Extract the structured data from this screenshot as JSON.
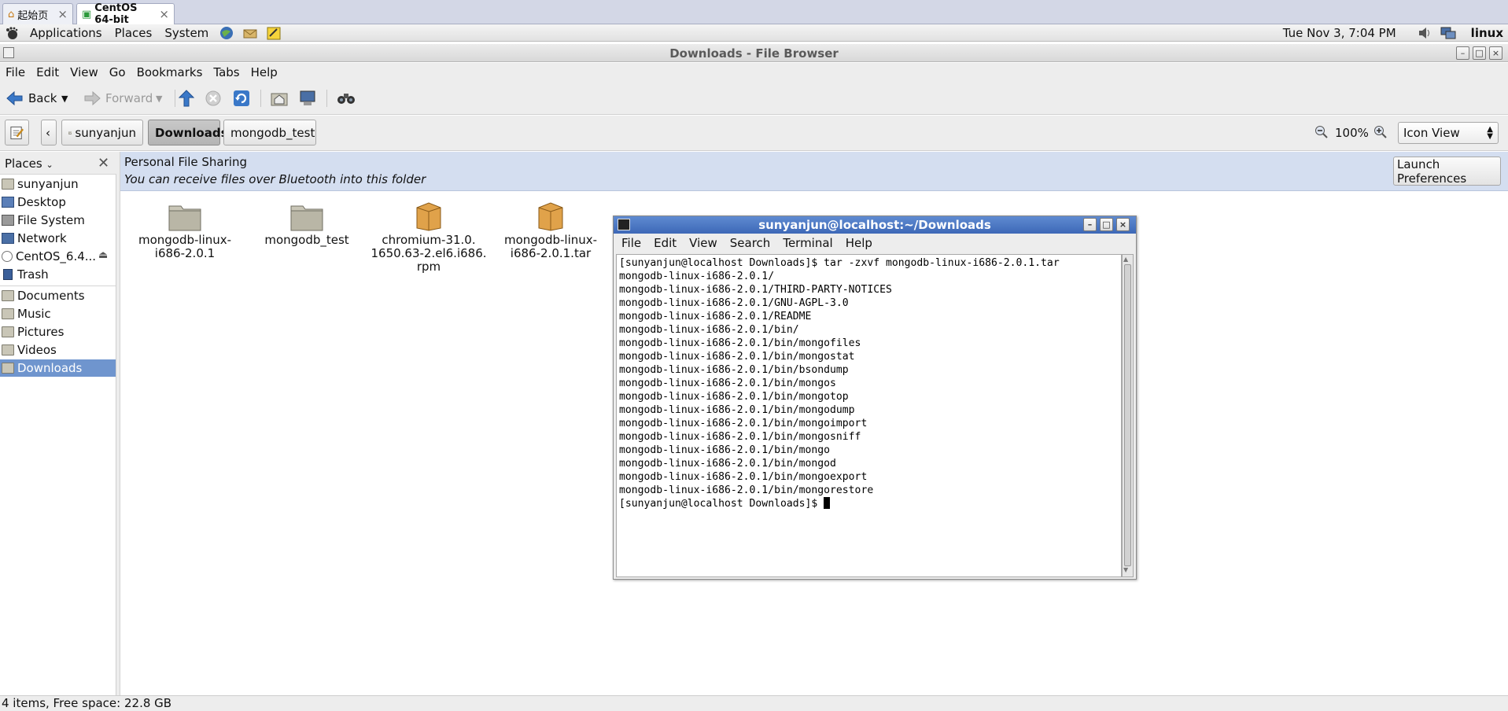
{
  "browser_tabs": [
    {
      "label": "起始页",
      "icon": "home-icon"
    },
    {
      "label": "CentOS 64-bit",
      "icon": "vm-icon"
    }
  ],
  "panel": {
    "menus": [
      "Applications",
      "Places",
      "System"
    ],
    "clock": "Tue Nov  3,  7:04 PM",
    "user": "linux"
  },
  "window": {
    "title": "Downloads - File Browser",
    "menu": [
      "File",
      "Edit",
      "View",
      "Go",
      "Bookmarks",
      "Tabs",
      "Help"
    ]
  },
  "toolbar": {
    "back": "Back",
    "forward": "Forward"
  },
  "location": {
    "path": [
      "sunyanjun",
      "Downloads",
      "mongodb_test"
    ],
    "zoom": "100%",
    "view_mode": "Icon View"
  },
  "sidebar": {
    "header": "Places",
    "items": [
      {
        "label": "sunyanjun",
        "icon": "home-folder-icon"
      },
      {
        "label": "Desktop",
        "icon": "desktop-icon"
      },
      {
        "label": "File System",
        "icon": "filesystem-icon"
      },
      {
        "label": "Network",
        "icon": "network-icon"
      },
      {
        "label": "CentOS_6.4...",
        "icon": "disc-icon"
      },
      {
        "label": "Trash",
        "icon": "trash-icon"
      },
      {
        "label": "Documents",
        "icon": "folder-icon"
      },
      {
        "label": "Music",
        "icon": "folder-icon"
      },
      {
        "label": "Pictures",
        "icon": "folder-icon"
      },
      {
        "label": "Videos",
        "icon": "folder-icon"
      },
      {
        "label": "Downloads",
        "icon": "folder-icon",
        "selected": true
      }
    ]
  },
  "infobar": {
    "title": "Personal File Sharing",
    "message": "You can receive files over Bluetooth into this folder",
    "button": "Launch Preferences"
  },
  "files": [
    {
      "name_line1": "mongodb-linux-",
      "name_line2": "i686-2.0.1",
      "name_line3": "",
      "type": "folder"
    },
    {
      "name_line1": "mongodb_test",
      "name_line2": "",
      "name_line3": "",
      "type": "folder"
    },
    {
      "name_line1": "chromium-31.0.",
      "name_line2": "1650.63-2.el6.i686.",
      "name_line3": "rpm",
      "type": "package"
    },
    {
      "name_line1": "mongodb-linux-",
      "name_line2": "i686-2.0.1.tar",
      "name_line3": "",
      "type": "package"
    }
  ],
  "status": "4 items, Free space: 22.8 GB",
  "terminal": {
    "title": "sunyanjun@localhost:~/Downloads",
    "menu": [
      "File",
      "Edit",
      "View",
      "Search",
      "Terminal",
      "Help"
    ],
    "lines": [
      "[sunyanjun@localhost Downloads]$ tar -zxvf mongodb-linux-i686-2.0.1.tar",
      "mongodb-linux-i686-2.0.1/",
      "mongodb-linux-i686-2.0.1/THIRD-PARTY-NOTICES",
      "mongodb-linux-i686-2.0.1/GNU-AGPL-3.0",
      "mongodb-linux-i686-2.0.1/README",
      "mongodb-linux-i686-2.0.1/bin/",
      "mongodb-linux-i686-2.0.1/bin/mongofiles",
      "mongodb-linux-i686-2.0.1/bin/mongostat",
      "mongodb-linux-i686-2.0.1/bin/bsondump",
      "mongodb-linux-i686-2.0.1/bin/mongos",
      "mongodb-linux-i686-2.0.1/bin/mongotop",
      "mongodb-linux-i686-2.0.1/bin/mongodump",
      "mongodb-linux-i686-2.0.1/bin/mongoimport",
      "mongodb-linux-i686-2.0.1/bin/mongosniff",
      "mongodb-linux-i686-2.0.1/bin/mongo",
      "mongodb-linux-i686-2.0.1/bin/mongod",
      "mongodb-linux-i686-2.0.1/bin/mongoexport",
      "mongodb-linux-i686-2.0.1/bin/mongorestore"
    ],
    "prompt": "[sunyanjun@localhost Downloads]$ "
  }
}
